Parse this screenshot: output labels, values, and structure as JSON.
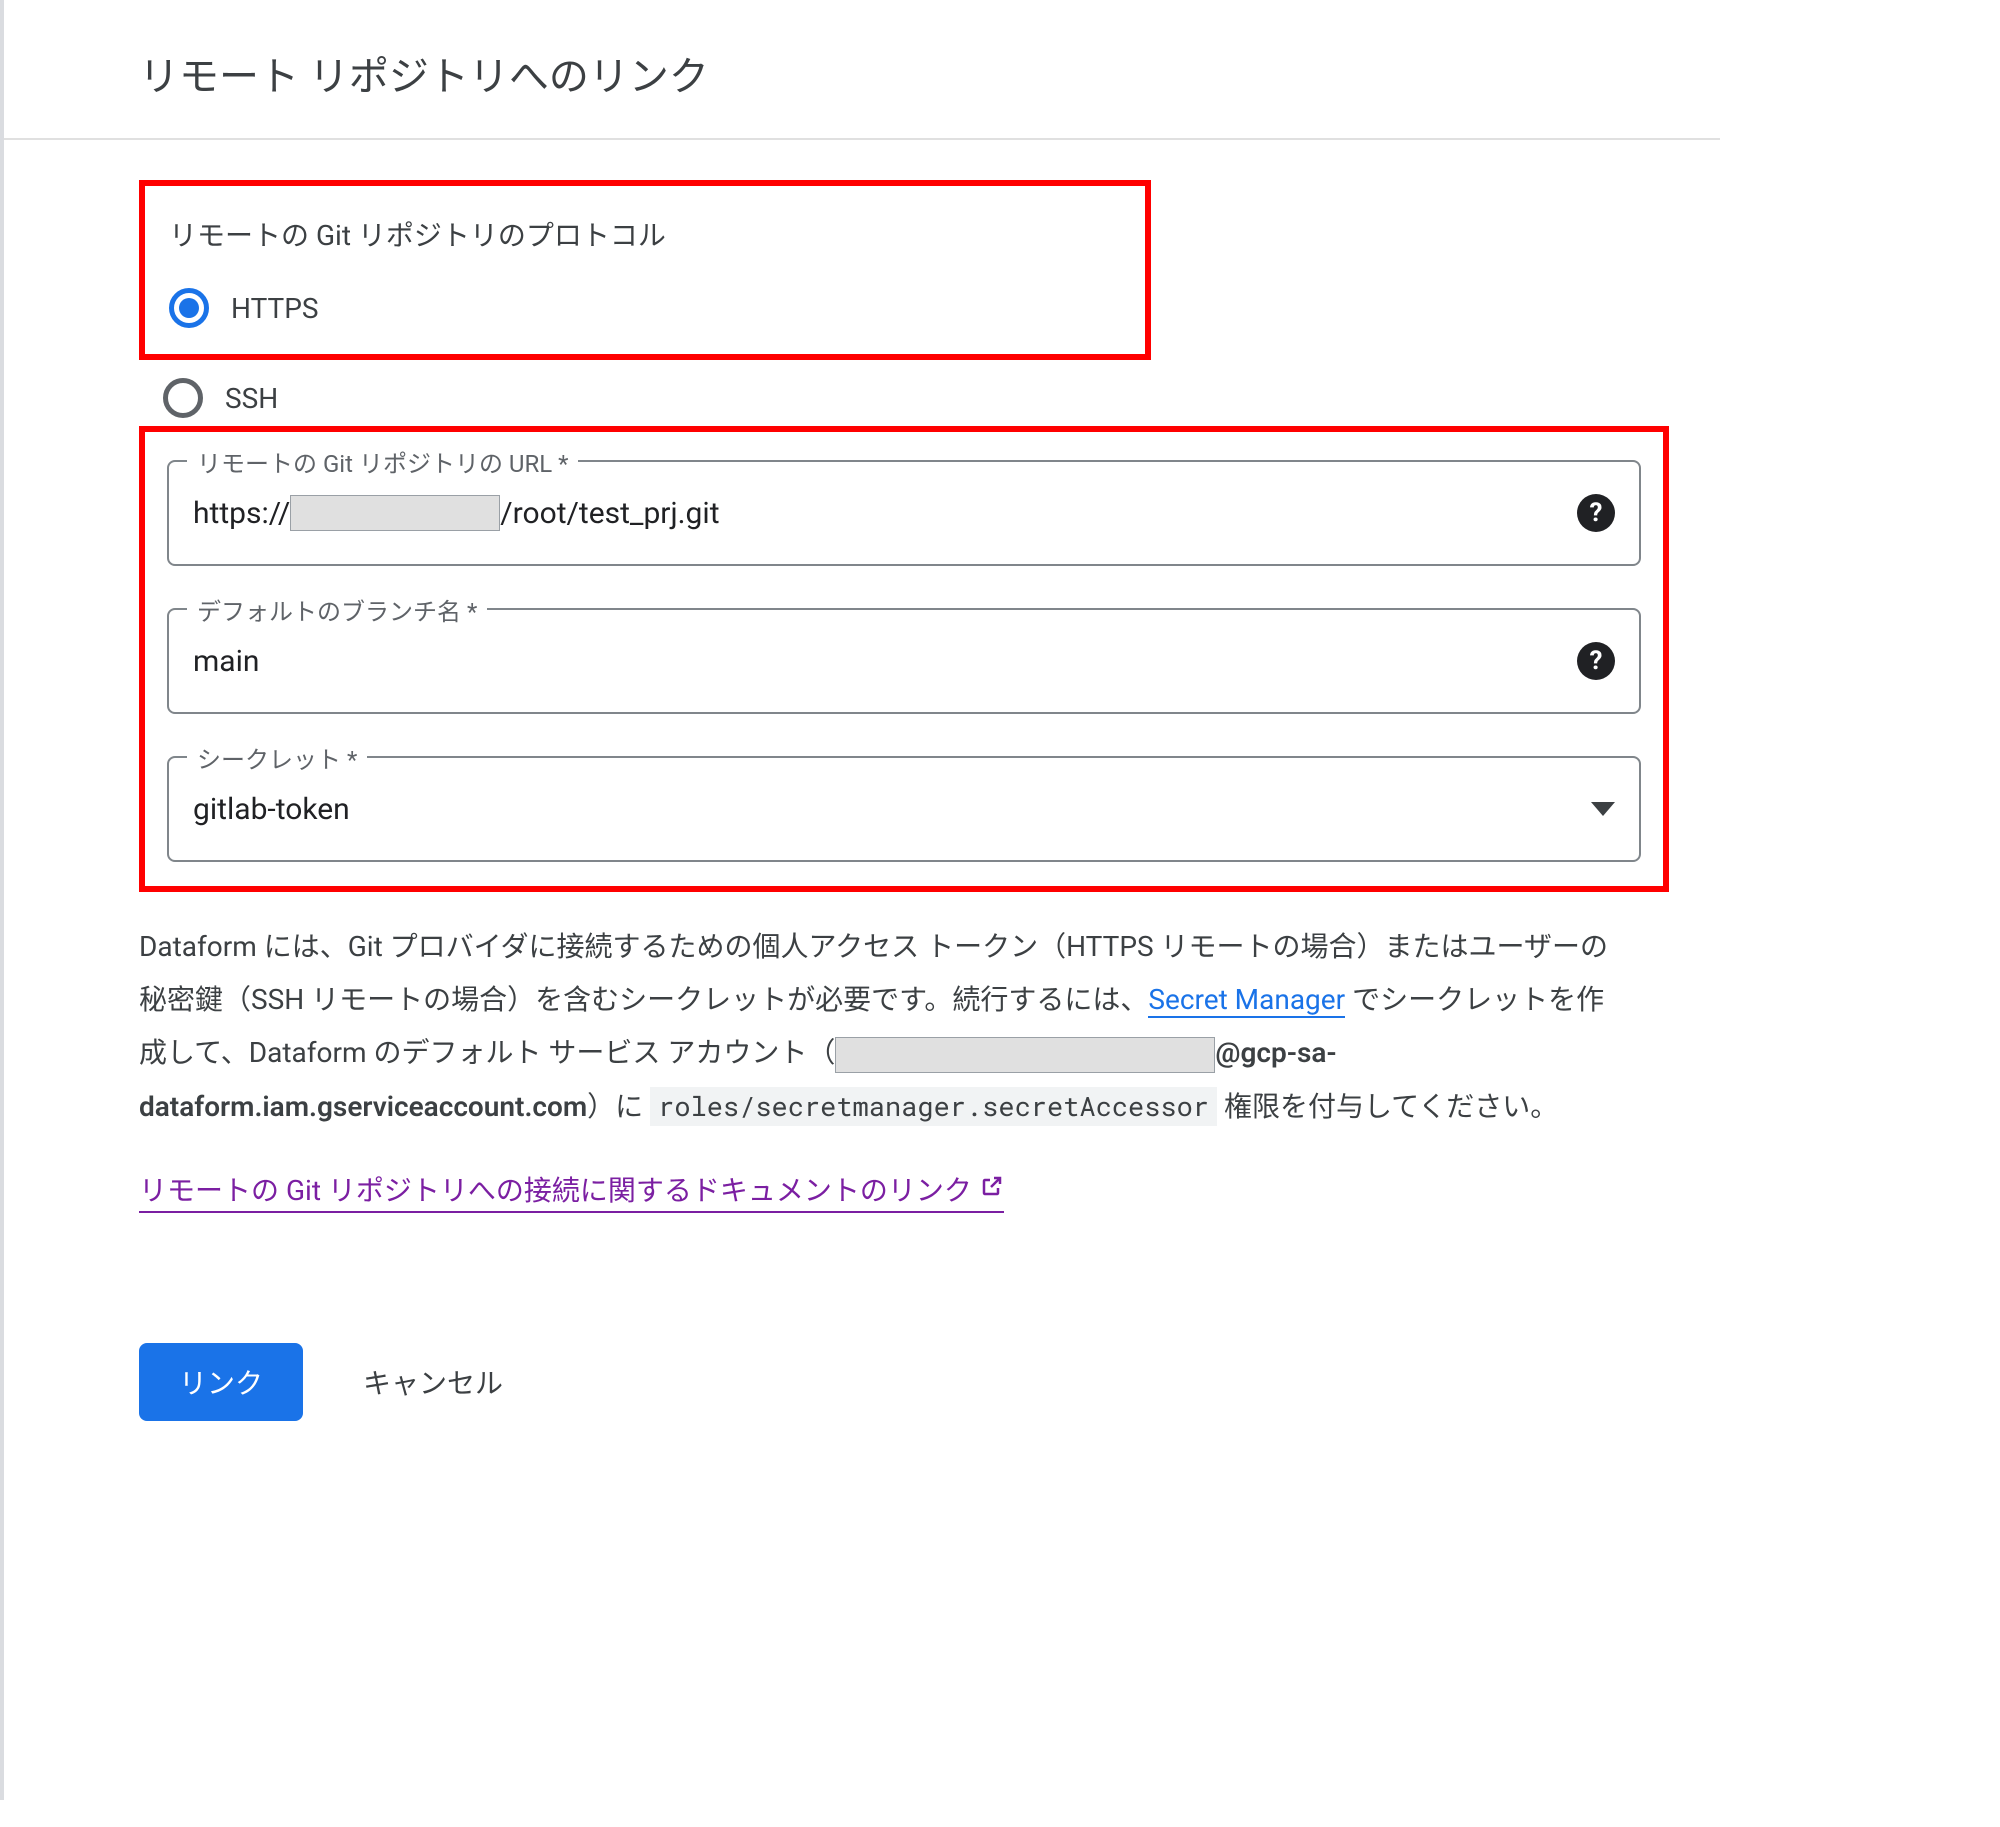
{
  "dialog": {
    "title": "リモート リポジトリへのリンク"
  },
  "protocol": {
    "label": "リモートの Git リポジトリのプロトコル",
    "options": {
      "https": "HTTPS",
      "ssh": "SSH"
    }
  },
  "fields": {
    "url": {
      "label": "リモートの Git リポジトリの URL *",
      "value_prefix": "https://",
      "value_suffix": "/root/test_prj.git"
    },
    "branch": {
      "label": "デフォルトのブランチ名 *",
      "value": "main"
    },
    "secret": {
      "label": "シークレット *",
      "value": "gitlab-token"
    }
  },
  "description": {
    "part1": "Dataform には、Git プロバイダに接続するための個人アクセス トークン（HTTPS リモートの場合）またはユーザーの秘密鍵（SSH リモートの場合）を含むシークレットが必要です。続行するには、",
    "secret_manager_link": "Secret Manager",
    "part2": " でシークレットを作成して、Dataform のデフォルト サービス アカウント（",
    "sa_suffix": "@gcp-sa-dataform.iam.gserviceaccount.com",
    "part3": "）に ",
    "role": "roles/secretmanager.secretAccessor",
    "part4": " 権限を付与してください。"
  },
  "doc_link": {
    "text": "リモートの Git リポジトリへの接続に関するドキュメントのリンク"
  },
  "buttons": {
    "link": "リンク",
    "cancel": "キャンセル"
  }
}
